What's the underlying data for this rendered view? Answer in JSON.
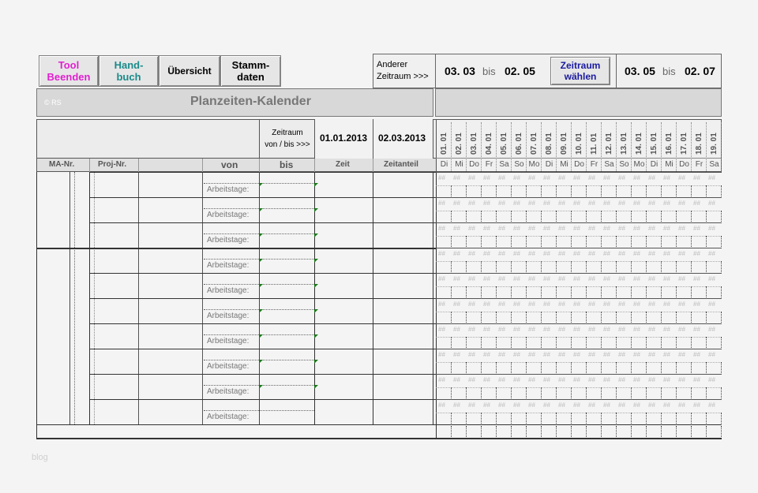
{
  "toolbar": {
    "tool_beenden": "Tool\nBeenden",
    "handbuch": "Hand-\nbuch",
    "uebersicht": "Übersicht",
    "stammdaten": "Stamm-\ndaten",
    "anderer_zeitraum": "Anderer\nZeitraum  >>>",
    "range1_from": "03. 03",
    "range1_bis": "bis",
    "range1_to": "02. 05",
    "zeitraum_waehlen": "Zeitraum\nwählen",
    "range2_from": "03. 05",
    "range2_bis": "bis",
    "range2_to": "02. 07"
  },
  "title_bar": {
    "copyright": "© RS",
    "title": "Planzeiten-Kalender"
  },
  "header": {
    "zeitraum_label": "Zeitraum\nvon / bis >>>",
    "date_from": "01.01.2013",
    "date_to": "02.03.2013",
    "col_ma": "MA-Nr.",
    "col_proj": "Proj-Nr.",
    "col_von": "von",
    "col_bis": "bis",
    "col_zeit": "Zeit",
    "col_zeitanteil": "Zeitanteil"
  },
  "calendar": {
    "dates": [
      "01. 01",
      "02. 01",
      "03. 01",
      "04. 01",
      "05. 01",
      "06. 01",
      "07. 01",
      "08. 01",
      "09. 01",
      "10. 01",
      "11. 01",
      "12. 01",
      "13. 01",
      "14. 01",
      "15. 01",
      "16. 01",
      "17. 01",
      "18. 01",
      "19. 01"
    ],
    "weekdays": [
      "Di",
      "Mi",
      "Do",
      "Fr",
      "Sa",
      "So",
      "Mo",
      "Di",
      "Mi",
      "Do",
      "Fr",
      "Sa",
      "So",
      "Mo",
      "Di",
      "Mi",
      "Do",
      "Fr",
      "Sa"
    ],
    "hatch": "##"
  },
  "rows": {
    "arbeitstage_label": "Arbeitstage:",
    "count": 10
  },
  "footer": {
    "watermark": "blog"
  },
  "colors": {
    "tool_beenden": "#e020d0",
    "handbuch": "#1a8a8a",
    "zeitraum_waehlen": "#1a1aa0",
    "title_text": "#777777",
    "marker_green": "#1a7a1a"
  }
}
